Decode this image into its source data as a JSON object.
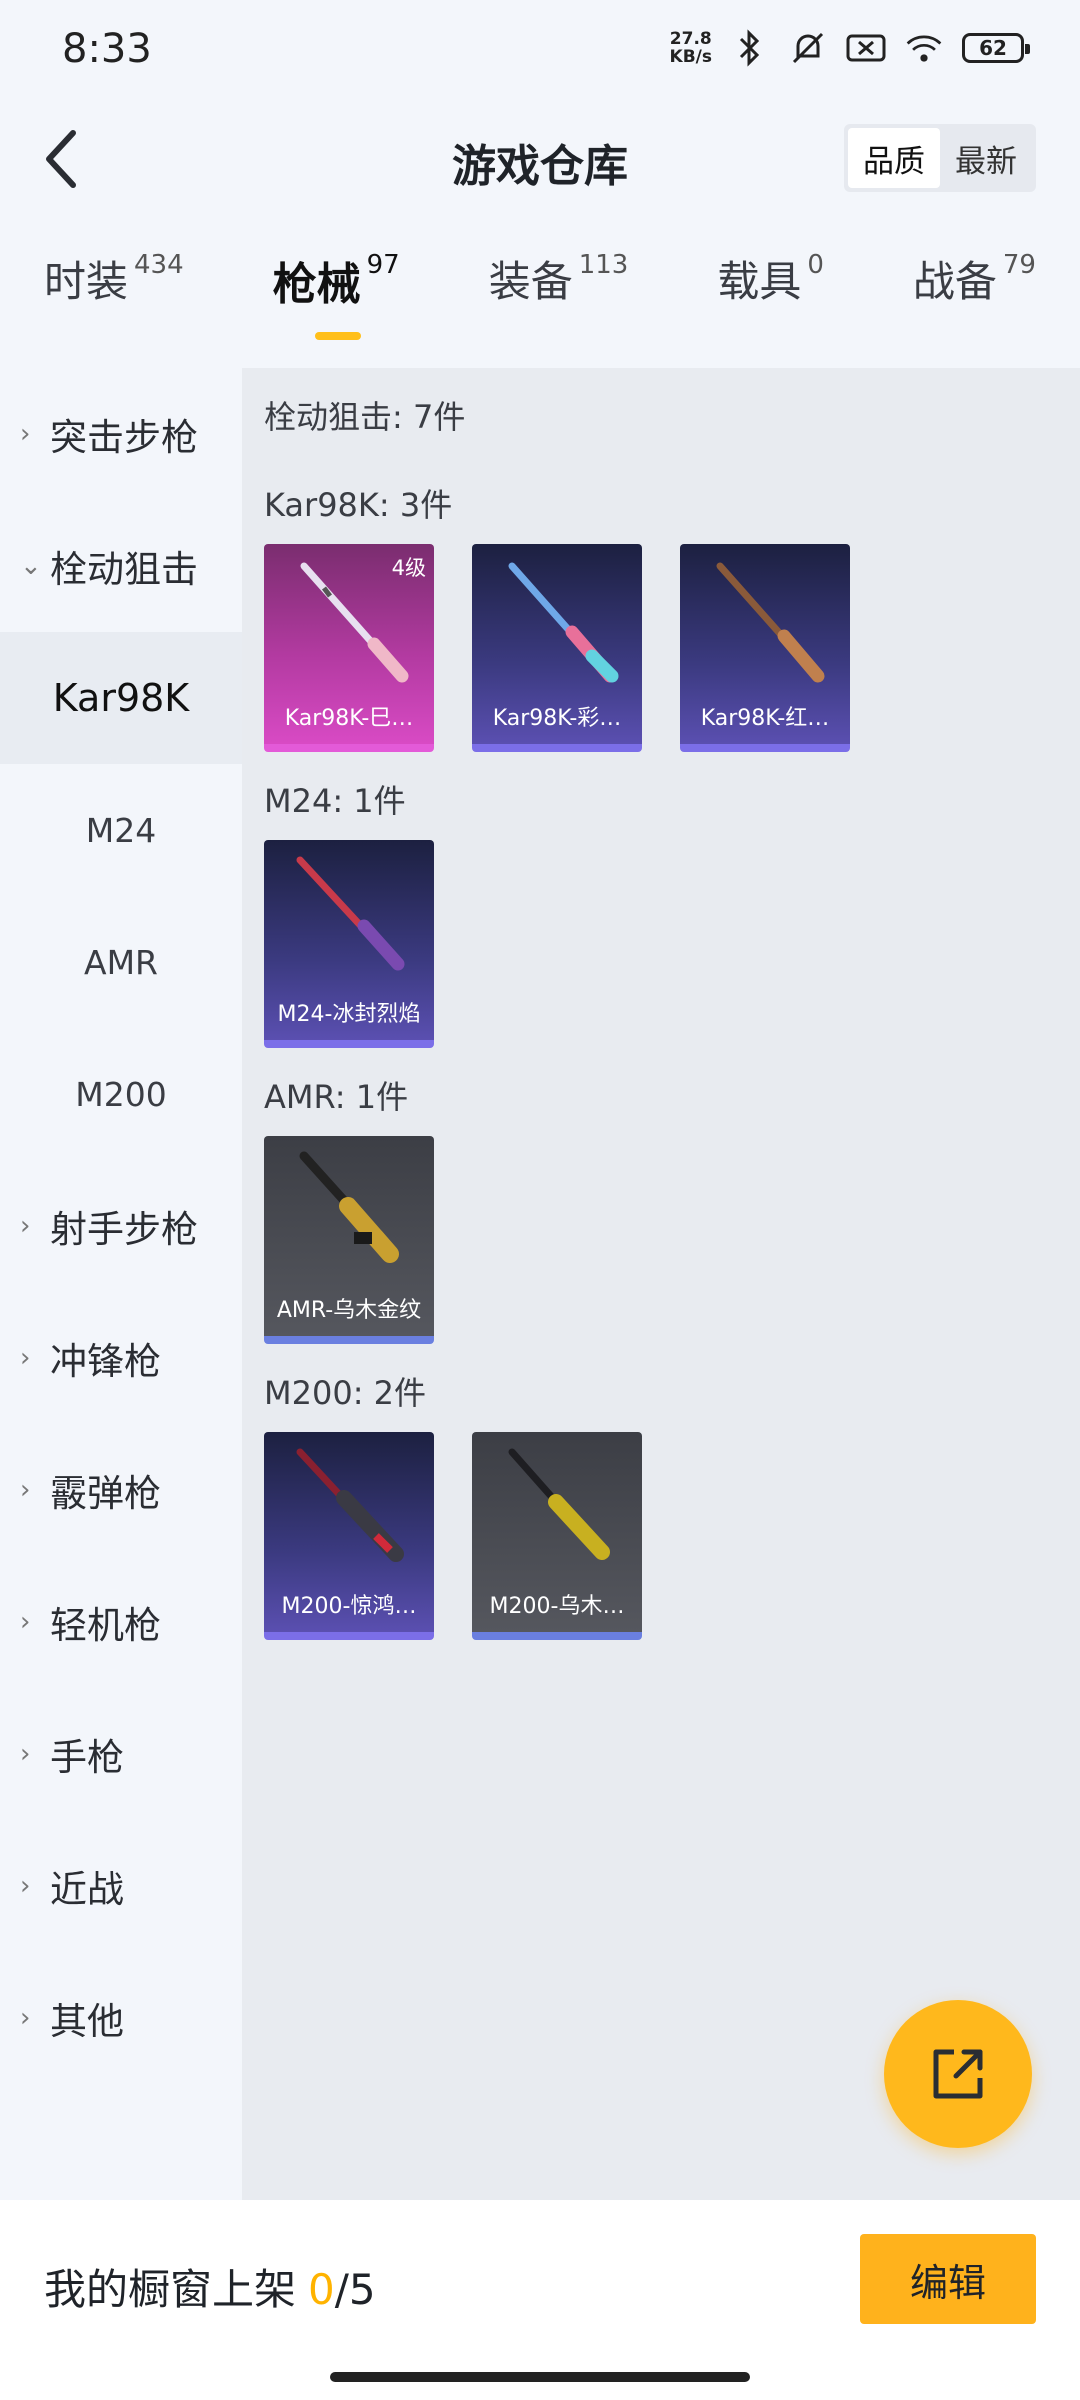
{
  "status": {
    "time": "8:33",
    "net_speed_top": "27.8",
    "net_speed_unit": "KB/s",
    "battery": "62"
  },
  "header": {
    "title": "游戏仓库",
    "sort": [
      "品质",
      "最新"
    ]
  },
  "tabs": [
    {
      "label": "时装",
      "count": "434"
    },
    {
      "label": "枪械",
      "count": "97"
    },
    {
      "label": "装备",
      "count": "113"
    },
    {
      "label": "载具",
      "count": "0"
    },
    {
      "label": "战备",
      "count": "79"
    }
  ],
  "sidebar": {
    "items": [
      {
        "label": "突击步枪"
      },
      {
        "label": "栓动狙击"
      },
      {
        "label": "Kar98K"
      },
      {
        "label": "M24"
      },
      {
        "label": "AMR"
      },
      {
        "label": "M200"
      },
      {
        "label": "射手步枪"
      },
      {
        "label": "冲锋枪"
      },
      {
        "label": "霰弹枪"
      },
      {
        "label": "轻机枪"
      },
      {
        "label": "手枪"
      },
      {
        "label": "近战"
      },
      {
        "label": "其他"
      }
    ]
  },
  "content": {
    "summary": "栓动狙击: 7件",
    "groups": [
      {
        "title": "Kar98K: 3件",
        "items": [
          {
            "name": "Kar98K-巳…",
            "level": "4级"
          },
          {
            "name": "Kar98K-彩…"
          },
          {
            "name": "Kar98K-红…"
          }
        ]
      },
      {
        "title": "M24: 1件",
        "items": [
          {
            "name": "M24-冰封烈焰"
          }
        ]
      },
      {
        "title": "AMR: 1件",
        "items": [
          {
            "name": "AMR-乌木金纹"
          }
        ]
      },
      {
        "title": "M200: 2件",
        "items": [
          {
            "name": "M200-惊鸿…"
          },
          {
            "name": "M200-乌木…"
          }
        ]
      }
    ]
  },
  "bottom": {
    "shelf_label": "我的橱窗上架",
    "shelf_count": "0",
    "shelf_total": "/5",
    "edit": "编辑"
  },
  "icons": {
    "back": "back-arrow-icon",
    "fab": "share-external-icon",
    "expand": "chevron-right-icon"
  },
  "colors": {
    "accent": "#ffb21c",
    "pink_rarity": "#e35ad8",
    "purple_rarity": "#7b6ee8"
  }
}
